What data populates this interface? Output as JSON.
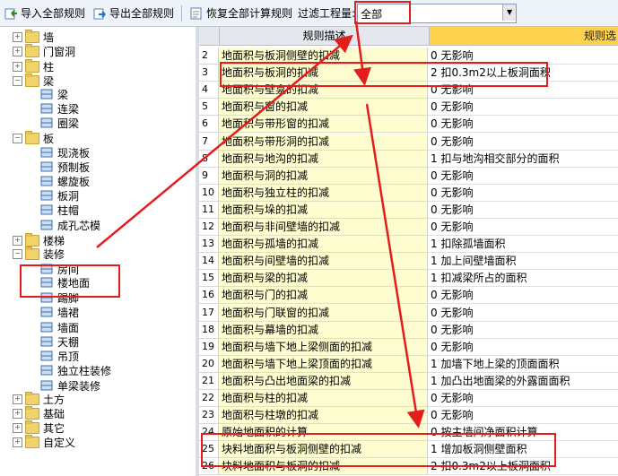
{
  "toolbar": {
    "import_label": "导入全部规则",
    "export_label": "导出全部规则",
    "restore_label": "恢复全部计算规则",
    "filter_label": "过滤工程量:",
    "filter_value": "全部"
  },
  "tree": [
    {
      "label": "墙",
      "type": "folder",
      "state": "collapsed"
    },
    {
      "label": "门窗洞",
      "type": "folder",
      "state": "collapsed"
    },
    {
      "label": "柱",
      "type": "folder",
      "state": "collapsed"
    },
    {
      "label": "梁",
      "type": "folder",
      "state": "expanded"
    },
    {
      "label": "梁",
      "type": "leaf",
      "icon": "beam-icon"
    },
    {
      "label": "连梁",
      "type": "leaf",
      "icon": "link-beam-icon"
    },
    {
      "label": "圈梁",
      "type": "leaf",
      "icon": "ring-beam-icon"
    },
    {
      "label": "板",
      "type": "folder",
      "state": "expanded"
    },
    {
      "label": "现浇板",
      "type": "leaf",
      "icon": "slab-icon"
    },
    {
      "label": "预制板",
      "type": "leaf",
      "icon": "precast-slab-icon"
    },
    {
      "label": "螺旋板",
      "type": "leaf",
      "icon": "spiral-slab-icon"
    },
    {
      "label": "板洞",
      "type": "leaf",
      "icon": "slab-hole-icon"
    },
    {
      "label": "柱帽",
      "type": "leaf",
      "icon": "column-cap-icon"
    },
    {
      "label": "成孔芯模",
      "type": "leaf",
      "icon": "core-mold-icon"
    },
    {
      "label": "楼梯",
      "type": "folder",
      "state": "collapsed"
    },
    {
      "label": "装修",
      "type": "folder",
      "state": "expanded"
    },
    {
      "label": "房间",
      "type": "leaf",
      "icon": "room-icon"
    },
    {
      "label": "楼地面",
      "type": "leaf",
      "icon": "floor-icon"
    },
    {
      "label": "踢脚",
      "type": "leaf",
      "icon": "skirting-icon"
    },
    {
      "label": "墙裙",
      "type": "leaf",
      "icon": "dado-icon"
    },
    {
      "label": "墙面",
      "type": "leaf",
      "icon": "wall-face-icon"
    },
    {
      "label": "天棚",
      "type": "leaf",
      "icon": "ceiling-icon"
    },
    {
      "label": "吊顶",
      "type": "leaf",
      "icon": "suspended-ceiling-icon"
    },
    {
      "label": "独立柱装修",
      "type": "leaf",
      "icon": "column-finish-icon"
    },
    {
      "label": "单梁装修",
      "type": "leaf",
      "icon": "beam-finish-icon"
    },
    {
      "label": "土方",
      "type": "folder",
      "state": "collapsed"
    },
    {
      "label": "基础",
      "type": "folder",
      "state": "collapsed"
    },
    {
      "label": "其它",
      "type": "folder",
      "state": "collapsed"
    },
    {
      "label": "自定义",
      "type": "folder",
      "state": "collapsed"
    }
  ],
  "grid": {
    "header_desc": "规则描述",
    "header_opt": "规则选",
    "rows": [
      {
        "num": "2",
        "desc": "地面积与板洞侧壁的扣减",
        "opt": "0  无影响"
      },
      {
        "num": "3",
        "desc": "地面积与板洞的扣减",
        "opt": "2  扣0.3m2以上板洞面积"
      },
      {
        "num": "4",
        "desc": "地面积与壁龛的扣减",
        "opt": "0  无影响"
      },
      {
        "num": "5",
        "desc": "地面积与窗的扣减",
        "opt": "0  无影响"
      },
      {
        "num": "6",
        "desc": "地面积与带形窗的扣减",
        "opt": "0  无影响"
      },
      {
        "num": "7",
        "desc": "地面积与带形洞的扣减",
        "opt": "0  无影响"
      },
      {
        "num": "8",
        "desc": "地面积与地沟的扣减",
        "opt": "1  扣与地沟相交部分的面积"
      },
      {
        "num": "9",
        "desc": "地面积与洞的扣减",
        "opt": "0  无影响"
      },
      {
        "num": "10",
        "desc": "地面积与独立柱的扣减",
        "opt": "0  无影响"
      },
      {
        "num": "11",
        "desc": "地面积与垛的扣减",
        "opt": "0  无影响"
      },
      {
        "num": "12",
        "desc": "地面积与非间壁墙的扣减",
        "opt": "0  无影响"
      },
      {
        "num": "13",
        "desc": "地面积与孤墙的扣减",
        "opt": "1  扣除孤墙面积"
      },
      {
        "num": "14",
        "desc": "地面积与间壁墙的扣减",
        "opt": "1  加上间壁墙面积"
      },
      {
        "num": "15",
        "desc": "地面积与梁的扣减",
        "opt": "1  扣减梁所占的面积"
      },
      {
        "num": "16",
        "desc": "地面积与门的扣减",
        "opt": "0  无影响"
      },
      {
        "num": "17",
        "desc": "地面积与门联窗的扣减",
        "opt": "0  无影响"
      },
      {
        "num": "18",
        "desc": "地面积与幕墙的扣减",
        "opt": "0  无影响"
      },
      {
        "num": "19",
        "desc": "地面积与墙下地上梁侧面的扣减",
        "opt": "0  无影响"
      },
      {
        "num": "20",
        "desc": "地面积与墙下地上梁顶面的扣减",
        "opt": "1  加墙下地上梁的顶面面积"
      },
      {
        "num": "21",
        "desc": "地面积与凸出地面梁的扣减",
        "opt": "1  加凸出地面梁的外露面面积"
      },
      {
        "num": "22",
        "desc": "地面积与柱的扣减",
        "opt": "0  无影响"
      },
      {
        "num": "23",
        "desc": "地面积与柱墩的扣减",
        "opt": "0  无影响"
      },
      {
        "num": "24",
        "desc": "原始地面积的计算",
        "opt": "0  按主墙间净面积计算"
      },
      {
        "num": "25",
        "desc": "块料地面积与板洞侧壁的扣减",
        "opt": "1  增加板洞侧壁面积"
      },
      {
        "num": "26",
        "desc": "块料地面积与板洞的扣减",
        "opt": "2  扣0.3m2以上板洞面积"
      }
    ]
  },
  "colors": {
    "annotation": "#e31c1c",
    "desc_bg": "#fdfdcf",
    "header_highlight": "#ffd24d"
  }
}
